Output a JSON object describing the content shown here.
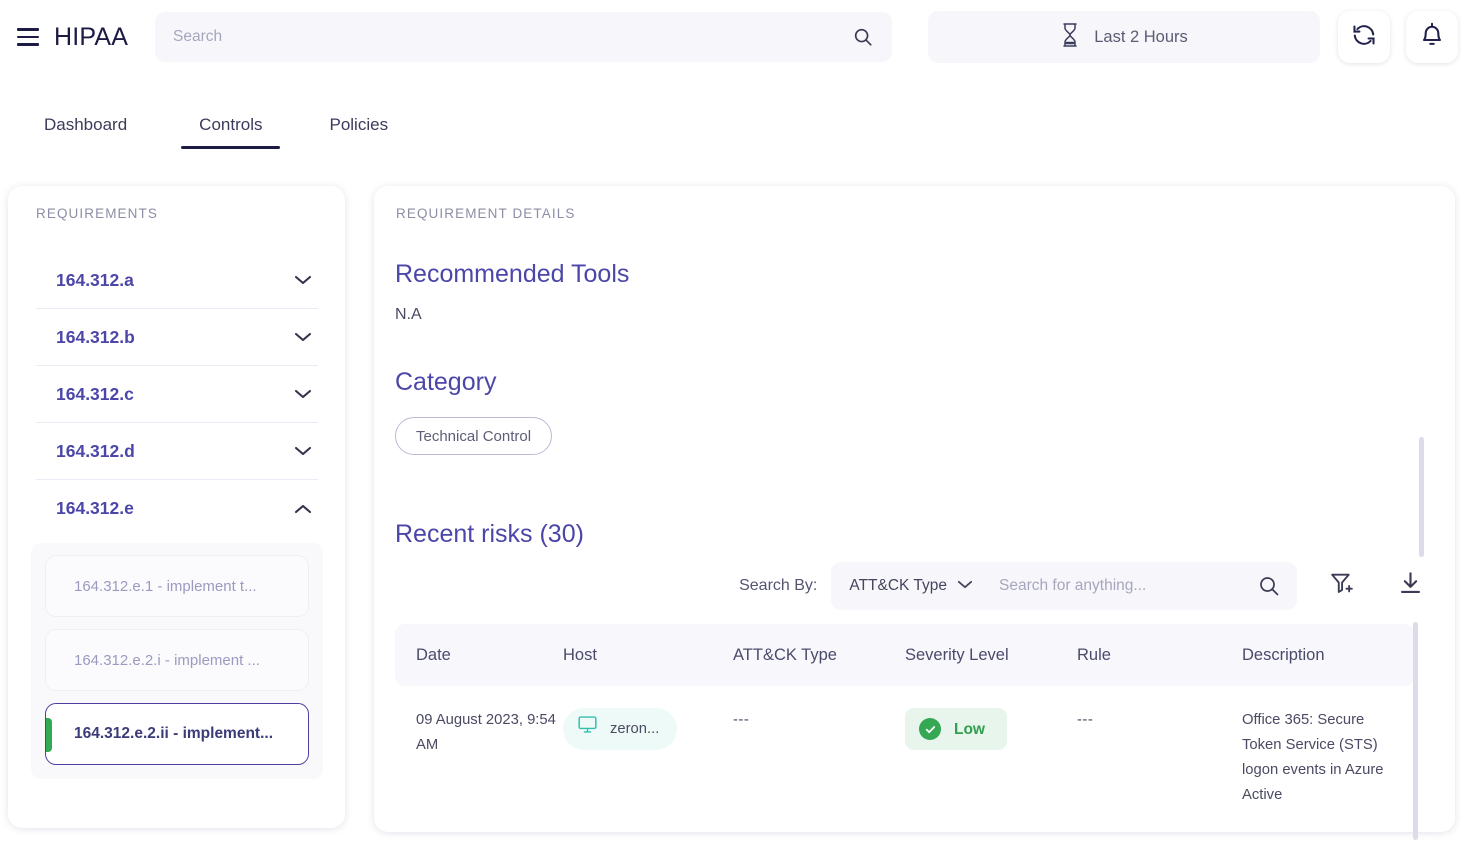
{
  "header": {
    "menu_icon": "hamburger-icon",
    "brand": "HIPAA",
    "search_placeholder": "Search",
    "search_value": "",
    "search_icon": "search-icon",
    "time_range_label": "Last 2 Hours",
    "time_range_icon": "hourglass-icon",
    "refresh_icon": "refresh-icon",
    "notifications_icon": "bell-icon"
  },
  "tabs": [
    {
      "label": "Dashboard",
      "active": false
    },
    {
      "label": "Controls",
      "active": true
    },
    {
      "label": "Policies",
      "active": false
    }
  ],
  "sidebar": {
    "title": "REQUIREMENTS",
    "items": [
      {
        "label": "164.312.a",
        "expanded": false,
        "chevron": "chevron-down-icon"
      },
      {
        "label": "164.312.b",
        "expanded": false,
        "chevron": "chevron-down-icon"
      },
      {
        "label": "164.312.c",
        "expanded": false,
        "chevron": "chevron-down-icon"
      },
      {
        "label": "164.312.d",
        "expanded": false,
        "chevron": "chevron-down-icon"
      },
      {
        "label": "164.312.e",
        "expanded": true,
        "chevron": "chevron-up-icon"
      }
    ],
    "sub_items": [
      {
        "label": "164.312.e.1 - implement t...",
        "selected": false
      },
      {
        "label": "164.312.e.2.i - implement ...",
        "selected": false
      },
      {
        "label": "164.312.e.2.ii - implement...",
        "selected": true
      }
    ]
  },
  "details": {
    "eyebrow": "REQUIREMENT DETAILS",
    "recommended_tools_heading": "Recommended Tools",
    "recommended_tools_value": "N.A",
    "category_heading": "Category",
    "category_chip": "Technical Control",
    "recent_risks_heading": "Recent risks (30)",
    "search_by_label": "Search By:",
    "search_by_value": "ATT&CK Type",
    "search_by_chevron": "chevron-down-icon",
    "risk_search_placeholder": "Search for anything...",
    "risk_search_value": "",
    "risk_search_icon": "search-icon",
    "add_filter_icon": "filter-add-icon",
    "download_icon": "download-icon"
  },
  "table": {
    "columns": [
      "Date",
      "Host",
      "ATT&CK Type",
      "Severity Level",
      "Rule",
      "Description"
    ],
    "rows": [
      {
        "date": "09 August 2023, 9:54 AM",
        "host": "zeron...",
        "host_icon": "monitor-icon",
        "attack_type": "---",
        "severity": "Low",
        "severity_icon": "check-circle-icon",
        "rule": "---",
        "description": "Office 365: Secure Token Service (STS) logon events in Azure Active"
      }
    ]
  },
  "colors": {
    "brand_dark": "#1b1b44",
    "accent_purple": "#4b46a8",
    "selected_border": "#4b3fa0",
    "status_green": "#34a853",
    "status_green_bg": "#e8f5ec",
    "host_chip_bg": "#eefaf7",
    "host_icon_teal": "#35bfae",
    "muted_text": "#8d8da5",
    "panel_bg": "#f7f7fb"
  }
}
